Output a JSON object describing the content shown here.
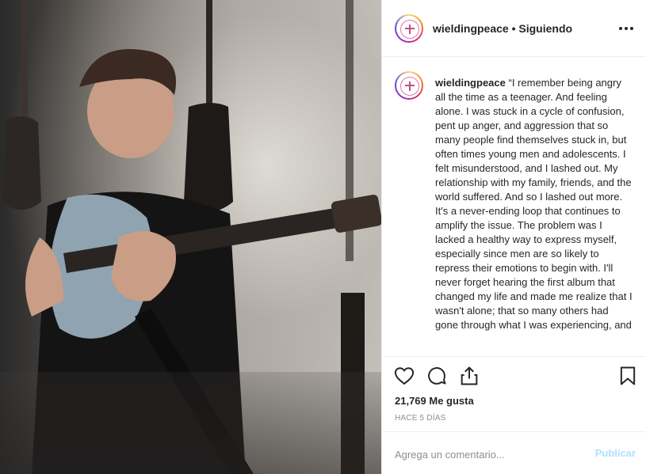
{
  "header": {
    "username": "wieldingpeace",
    "separator": "•",
    "follow_status": "Siguiendo",
    "more_icon": "more-horizontal-icon"
  },
  "caption": {
    "username": "wieldingpeace",
    "text": "“I remember being angry all the time as a teenager. And feeling alone. I was stuck in a cycle of confusion, pent up anger, and aggression that so many people find themselves stuck in, but often times young men and adolescents. I felt misunderstood, and I lashed out. My relationship with my family, friends, and the world suffered. And so I lashed out more. It's a never-ending loop that continues to amplify the issue. The problem was I lacked a healthy way to express myself, especially since men are so likely to repress their emotions to begin with. I'll never forget hearing the first album that changed my life and made me realize that I wasn't alone; that so many others had gone through what I was experiencing, and"
  },
  "actions": {
    "like_icon": "heart-icon",
    "comment_icon": "comment-icon",
    "share_icon": "share-icon",
    "save_icon": "bookmark-icon",
    "likes": "21,769 Me gusta",
    "time": "HACE 5 DÍAS"
  },
  "comment": {
    "placeholder": "Agrega un comentario...",
    "publish_label": "Publicar"
  },
  "colors": {
    "text": "#262626",
    "muted": "#8e8e8e",
    "border": "#efefef",
    "publish_disabled": "#b2dffc"
  }
}
